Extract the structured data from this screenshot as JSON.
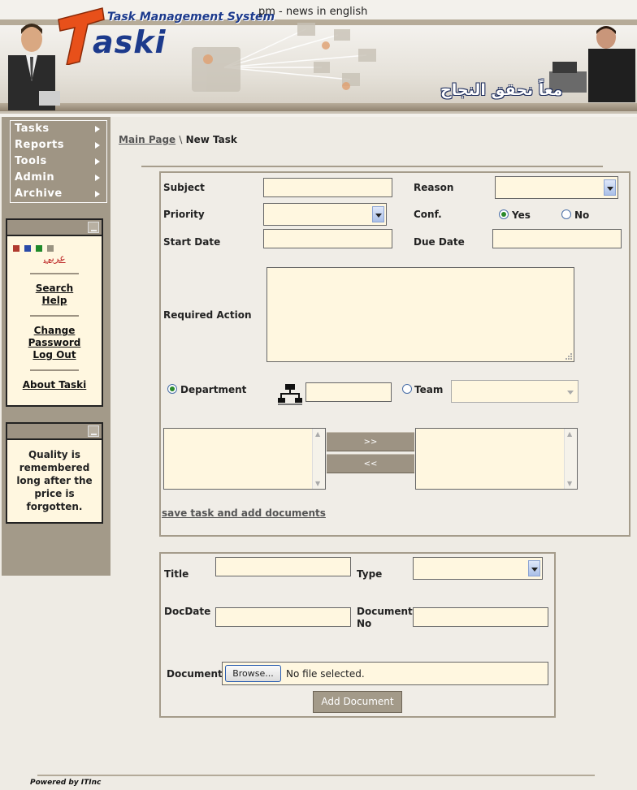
{
  "header": {
    "news_link": "pm - news in english",
    "brand_title": "Task Management System",
    "logo_word": "aski",
    "slogan": "معاً نحقق النجاح"
  },
  "menu": [
    {
      "label": "Tasks"
    },
    {
      "label": "Reports"
    },
    {
      "label": "Tools"
    },
    {
      "label": "Admin"
    },
    {
      "label": "Archive"
    }
  ],
  "panel1": {
    "color_swatches": [
      "#b03a2e",
      "#2a4aa8",
      "#1f8a2a",
      "#9a9482"
    ],
    "arabic_link": "عربي",
    "search": "Search",
    "help": "Help",
    "change_password": "Change Password",
    "logout": "Log Out",
    "about": "About Taski"
  },
  "panel2": {
    "quote": "Quality is remembered long after the price is forgotten."
  },
  "breadcrumb": {
    "main": "Main Page",
    "sep": "\\",
    "current": "New Task"
  },
  "task_form": {
    "subject_label": "Subject",
    "reason_label": "Reason",
    "priority_label": "Priority",
    "conf_label": "Conf.",
    "yes_label": "Yes",
    "no_label": "No",
    "conf_value": "Yes",
    "start_date_label": "Start Date",
    "due_date_label": "Due Date",
    "required_action_label": "Required Action",
    "department_label": "Department",
    "team_label": "Team",
    "assign_target": "Department",
    "add_btn": ">>",
    "remove_btn": "<<",
    "save_link": "save task and add documents"
  },
  "doc_form": {
    "title_label": "Title",
    "type_label": "Type",
    "docdate_label": "DocDate",
    "docno_label": "Document No",
    "document_label": "Document",
    "browse_label": "Browse...",
    "no_file": "No file selected.",
    "add_document": "Add Document"
  },
  "footer": {
    "powered": "Powered by ITInc"
  }
}
